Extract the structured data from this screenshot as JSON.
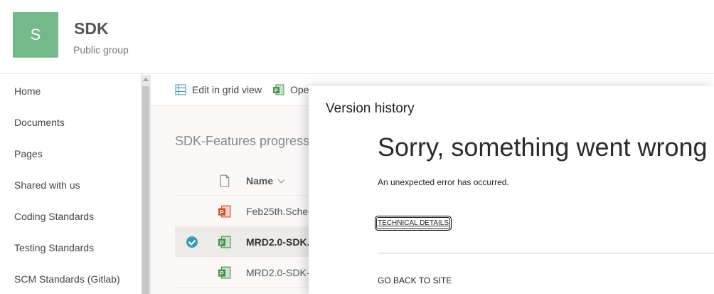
{
  "header": {
    "logo_letter": "S",
    "group_name": "SDK",
    "group_type": "Public group"
  },
  "leftnav": {
    "items": [
      {
        "label": "Home"
      },
      {
        "label": "Documents"
      },
      {
        "label": "Pages"
      },
      {
        "label": "Shared with us"
      },
      {
        "label": "Coding Standards"
      },
      {
        "label": "Testing Standards"
      },
      {
        "label": "SCM Standards (Gitlab)"
      }
    ]
  },
  "commandbar": {
    "edit_grid": "Edit in grid view",
    "open": "Ope"
  },
  "library": {
    "title": "SDK-Features progress",
    "name_column": "Name",
    "files": [
      {
        "name": "Feb25th.Schec",
        "icon": "powerpoint-icon",
        "selected": false
      },
      {
        "name": "MRD2.0-SDK.",
        "icon": "project-icon",
        "selected": true
      },
      {
        "name": "MRD2.0-SDK-",
        "icon": "project-icon",
        "selected": false
      }
    ]
  },
  "version_panel": {
    "title": "Version history",
    "error_title": "Sorry, something went wrong",
    "error_message": "An unexpected error has occurred.",
    "technical_details": "TECHNICAL DETAILS",
    "go_back": "GO BACK TO SITE"
  },
  "colors": {
    "logo_bg": "#74b98a",
    "check_accent": "#3d9bb3",
    "powerpoint": "#d35230",
    "project": "#4b8f4b"
  }
}
